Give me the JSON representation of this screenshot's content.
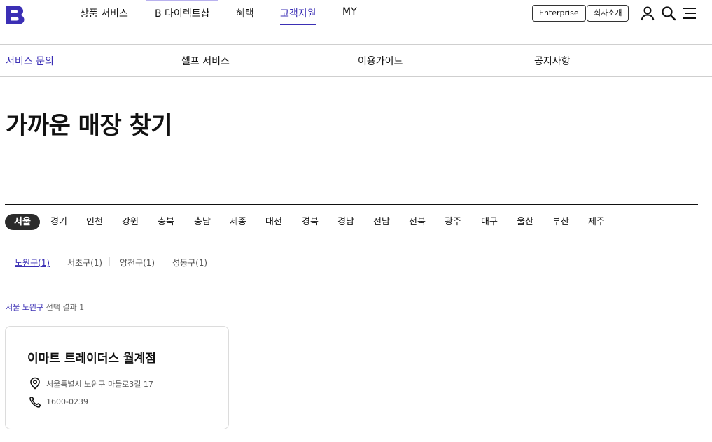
{
  "header": {
    "logo_color": "#3b2fb5",
    "nav": [
      {
        "label": "상품 서비스"
      },
      {
        "label": "B 다이렉트샵"
      },
      {
        "label": "혜택"
      },
      {
        "label": "고객지원",
        "active": true
      },
      {
        "label": "MY"
      }
    ],
    "enterprise_label": "Enterprise",
    "company_label": "회사소개",
    "icons": [
      "user-icon",
      "search-icon",
      "menu-icon"
    ]
  },
  "subnav": [
    {
      "label": "서비스 문의",
      "active": true
    },
    {
      "label": "셀프 서비스"
    },
    {
      "label": "이용가이드"
    },
    {
      "label": "공지사항"
    }
  ],
  "page_title": "가까운 매장 찾기",
  "regions": [
    "서울",
    "경기",
    "인천",
    "강원",
    "충북",
    "충남",
    "세종",
    "대전",
    "경북",
    "경남",
    "전남",
    "전북",
    "광주",
    "대구",
    "울산",
    "부산",
    "제주"
  ],
  "selected_region": "서울",
  "districts": [
    {
      "label": "노원구(1)",
      "active": true
    },
    {
      "label": "서초구(1)"
    },
    {
      "label": "양천구(1)"
    },
    {
      "label": "성동구(1)"
    }
  ],
  "result": {
    "highlight": "서울 노원구",
    "suffix": " 선택 결과 1"
  },
  "store": {
    "name": "이마트 트레이더스 월계점",
    "address": "서울특별시 노원구 마들로3길 17",
    "phone": "1600-0239"
  },
  "colors": {
    "accent": "#3b2fb5",
    "active_tab_bg": "#2b2b2b"
  }
}
